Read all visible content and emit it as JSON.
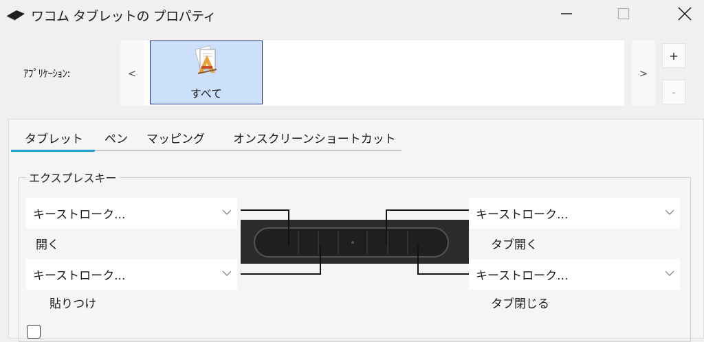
{
  "window": {
    "title": "ワコム タブレットの プロパティ"
  },
  "applications": {
    "label": "ｱﾌﾟﾘｹｰｼｮﾝ:",
    "scroll_left": "<",
    "scroll_right": ">",
    "add_label": "+",
    "remove_label": "-",
    "items": [
      {
        "label": "すべて",
        "selected": true
      }
    ]
  },
  "tabs": [
    {
      "label": "タブレット",
      "active": true
    },
    {
      "label": "ペン",
      "active": false
    },
    {
      "label": "マッピング",
      "active": false
    },
    {
      "label": "オンスクリーンショートカット",
      "active": false
    }
  ],
  "express_keys": {
    "group_title": "エクスプレスキー",
    "keys": [
      {
        "value": "キーストローク...",
        "caption": "開く"
      },
      {
        "value": "キーストローク...",
        "caption": "貼りつけ"
      },
      {
        "value": "キーストローク...",
        "caption": "タブ開く"
      },
      {
        "value": "キーストローク...",
        "caption": "タブ閉じる"
      }
    ]
  },
  "colors": {
    "accent": "#1e9bd7",
    "selection": "#cce0fb",
    "selection_border": "#1d2d8c"
  }
}
